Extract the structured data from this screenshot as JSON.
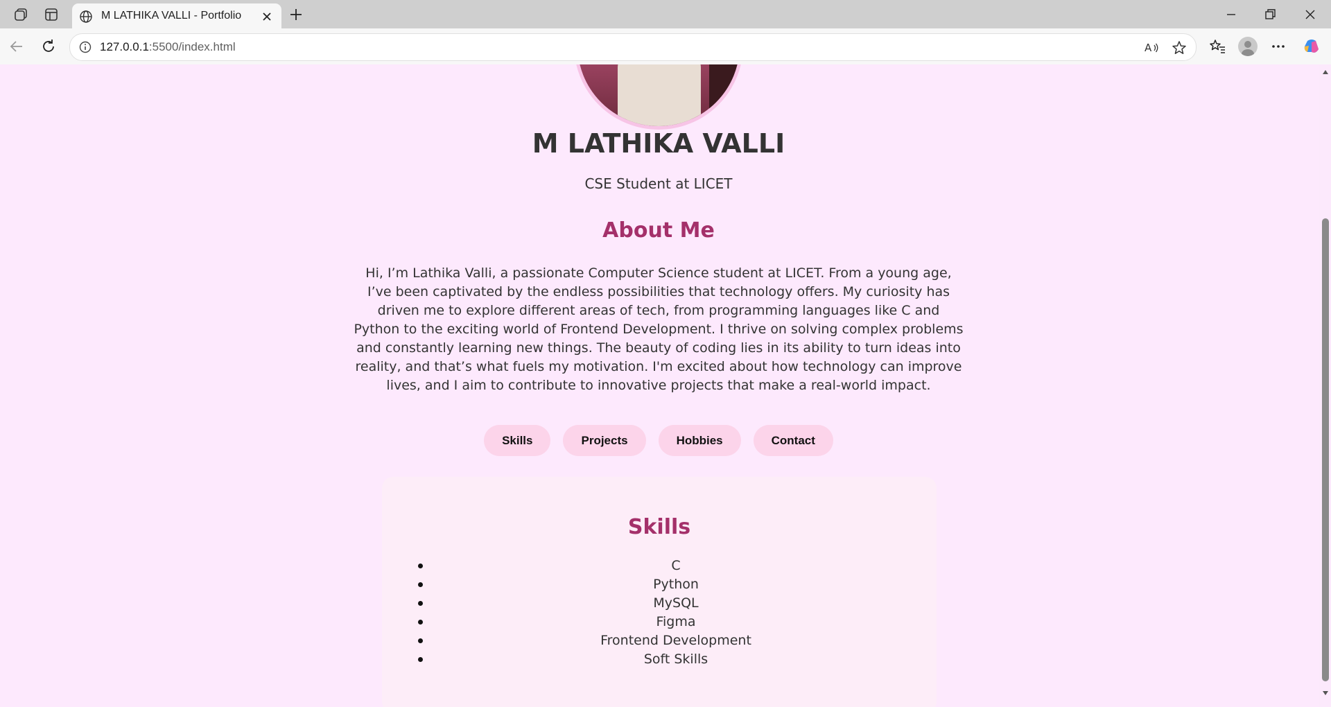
{
  "browser": {
    "tab_title": "M LATHIKA VALLI - Portfolio",
    "url_host": "127.0.0.1",
    "url_path": ":5500/index.html"
  },
  "profile": {
    "name": "M LATHIKA VALLI",
    "subtitle": "CSE Student at LICET"
  },
  "about": {
    "title": "About Me",
    "text": "Hi, I’m Lathika Valli, a passionate Computer Science student at LICET. From a young age, I’ve been captivated by the endless possibilities that technology offers. My curiosity has driven me to explore different areas of tech, from programming languages like C and Python to the exciting world of Frontend Development. I thrive on solving complex problems and constantly learning new things. The beauty of coding lies in its ability to turn ideas into reality, and that’s what fuels my motivation. I'm excited about how technology can improve lives, and I aim to contribute to innovative projects that make a real-world impact."
  },
  "nav": [
    {
      "label": "Skills"
    },
    {
      "label": "Projects"
    },
    {
      "label": "Hobbies"
    },
    {
      "label": "Contact"
    }
  ],
  "skills": {
    "title": "Skills",
    "items": [
      "C",
      "Python",
      "MySQL",
      "Figma",
      "Frontend Development",
      "Soft Skills"
    ]
  },
  "colors": {
    "page_bg": "#fde9fd",
    "accent": "#a4306a",
    "pill_bg": "#fcd4ea",
    "card_bg": "#fdedf8"
  }
}
